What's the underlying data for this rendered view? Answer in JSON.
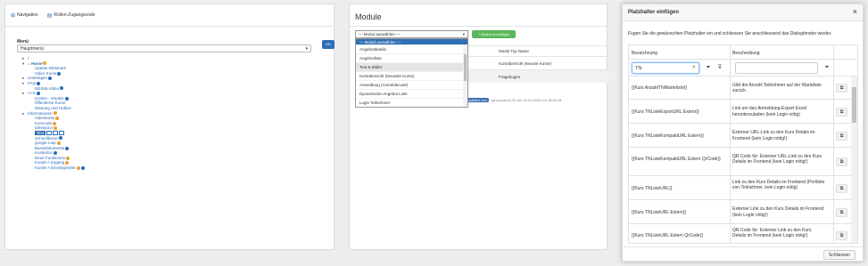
{
  "panel1": {
    "tabs": [
      {
        "label": "Navigation",
        "icon": "sitemap-icon"
      },
      {
        "label": "Rollen-Zugangscode",
        "icon": "file-icon"
      }
    ],
    "menu_label": "Menü",
    "menu_value": "Hauptmenü",
    "ok_label": "OK",
    "tree": [
      {
        "label": "/",
        "arrow": "▸",
        "indent": 0,
        "type": "plain"
      },
      {
        "label": "Home",
        "arrow": "▾",
        "indent": 0,
        "type": "link",
        "badge": "o"
      },
      {
        "label": "Update-Webinare",
        "indent": 1,
        "type": "link"
      },
      {
        "label": "Video Kurse",
        "indent": 1,
        "type": "link",
        "badge": "u"
      },
      {
        "label": "Unterlagen",
        "arrow": "▸",
        "indent": 0,
        "type": "link",
        "badge": "u"
      },
      {
        "label": "FAQ",
        "arrow": "▸",
        "indent": 0,
        "type": "link",
        "badge": "u"
      },
      {
        "label": "MS365-Video",
        "indent": 1,
        "type": "link",
        "badge": "u"
      },
      {
        "label": "A+S",
        "arrow": "▸",
        "indent": 0,
        "type": "link",
        "badge": "u"
      },
      {
        "label": "Kosten - Module",
        "indent": 1,
        "type": "link",
        "badge": "u"
      },
      {
        "label": "Öffentliche Kurse",
        "indent": 1,
        "type": "link"
      },
      {
        "label": "Wartung und Hotfixe",
        "indent": 1,
        "type": "link"
      },
      {
        "label": "Informationen",
        "arrow": "▸",
        "indent": 0,
        "type": "link",
        "badge": "o"
      },
      {
        "label": "Videokurse",
        "indent": 1,
        "type": "link",
        "badge": "o"
      },
      {
        "label": "Kurscode",
        "indent": 1,
        "type": "link",
        "badge": "o"
      },
      {
        "label": "Ideenpool",
        "indent": 1,
        "type": "link",
        "badge": "o"
      },
      {
        "label": "Test",
        "indent": 1,
        "type": "selected"
      },
      {
        "label": "Schnellkurse",
        "indent": 1,
        "type": "link",
        "badge": "u"
      },
      {
        "label": "google-map",
        "indent": 1,
        "type": "link",
        "badge": "o"
      },
      {
        "label": "Basisdokumente",
        "indent": 1,
        "type": "link",
        "badge": "u"
      },
      {
        "label": "Kostenlos",
        "indent": 1,
        "type": "link",
        "badge": "u"
      },
      {
        "label": "Neue Funktionen",
        "indent": 1,
        "type": "link",
        "badge": "o"
      },
      {
        "label": "Kunde A Zugang",
        "indent": 1,
        "type": "link",
        "badge": "o"
      },
      {
        "label": "Kunde A Einstiegsseite",
        "indent": 1,
        "type": "link",
        "badge": "ou"
      }
    ]
  },
  "panel2": {
    "title": "Module",
    "select_value": "— Modul auswählen —",
    "add_label": "+ Modul hinzufügen",
    "options": [
      "— Modul auswählen —",
      "Angebotdetails",
      "Angebotliste",
      "Text & Bilder",
      "Kursübersicht (Neueste Kurse)",
      "Anmeldung (Anmeldecode)",
      "Dynamische-Angebot Liste",
      "Login Teilnehmer"
    ],
    "table_header": "Modul Typ Name",
    "table_rows": [
      "Kursübersicht (Neuste Kurse)",
      "Fragebogen"
    ],
    "footer_pill": "aktualisiert von",
    "footer_text": "(anno.kaezl) 32 am 16.10.2023 um 15:40:34"
  },
  "dialog": {
    "title": "Platzhalter einfügen",
    "close": "×",
    "instruction": "Fügen Sie die gewünschten Platzhalter ein und schliessen Sie anschliessend das Dialogfenster wieder.",
    "col_name": "Bezeichnung",
    "col_desc": "Beschreibung",
    "filter_value": "TN",
    "clear": "✕",
    "rows": [
      {
        "name": "{{Kurs AnzahlTNWarteliste}}",
        "desc": "Gibt die Anzahl Teilnehmer auf der Warteliste zurück."
      },
      {
        "name": "{{Kurs TNListeExportURL Extern}}",
        "desc": "Link um das Anmeldung-Export Excel herunterzuladen (kein Login nötig)"
      },
      {
        "name": "{{Kurs TNListeKompaktURL Extern}}",
        "desc": "Externer URL-Link zu den Kurs Details im Frontend (kein Login nötig!)"
      },
      {
        "name": "{{Kurs TNListeKompaktURL Extern QrCode}}",
        "desc": "QR Code für: Externer URL-Link zu den Kurs Details im Frontend (kein Login nötig!)"
      },
      {
        "name": "{{Kurs TNListeURL}}",
        "desc": "Link zu den Kurs Details im Frontend (Portfolio von Teilnehmer, kein Login nötig)"
      },
      {
        "name": "{{Kurs TNListeURL Extern}}",
        "desc": "Externer Link zu den Kurs Details im Frontend (kein Login nötig!)"
      },
      {
        "name": "{{Kurs TNListeURL Extern QrCode}}",
        "desc": "QR Code für: Externer Link zu den Kurs Details im Frontend (kein Login nötig!)"
      }
    ],
    "close_button": "Schliessen"
  }
}
